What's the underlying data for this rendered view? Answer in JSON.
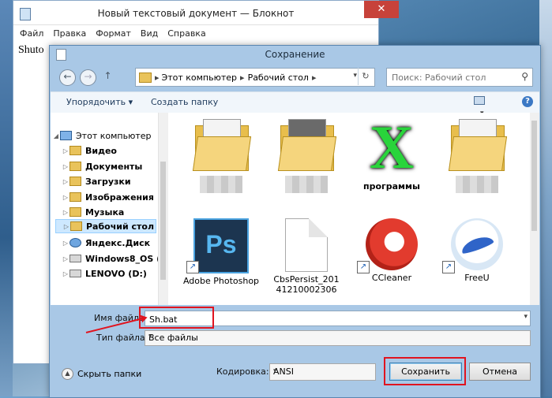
{
  "notepad": {
    "title": "Новый текстовый документ — Блокнот",
    "menu": [
      "Файл",
      "Правка",
      "Формат",
      "Вид",
      "Справка"
    ],
    "body_text": "Shuto",
    "close_glyph": "✕"
  },
  "dialog": {
    "title": "Сохранение",
    "nav": {
      "back": "←",
      "forward": "→",
      "up": "↑"
    },
    "address": {
      "segments": [
        "Этот компьютер",
        "Рабочий стол"
      ],
      "sep": "▸",
      "dropdown": "▾",
      "refresh": "↻"
    },
    "search": {
      "placeholder": "Поиск: Рабочий стол",
      "icon": "⚲"
    },
    "toolbar": {
      "organize": "Упорядочить ▾",
      "new_folder": "Создать папку",
      "help": "?",
      "view_caret": "▾"
    },
    "tree": [
      {
        "label": "Этот компьютер",
        "icon": "pc-icon",
        "expand": "◢"
      },
      {
        "label": "Видео",
        "icon": "folder-icon",
        "expand": "▷"
      },
      {
        "label": "Документы",
        "icon": "folder-icon",
        "expand": "▷"
      },
      {
        "label": "Загрузки",
        "icon": "folder-icon",
        "expand": "▷"
      },
      {
        "label": "Изображения",
        "icon": "folder-icon",
        "expand": "▷"
      },
      {
        "label": "Музыка",
        "icon": "folder-icon",
        "expand": "▷"
      },
      {
        "label": "Рабочий стол",
        "icon": "folder-icon",
        "expand": "▷",
        "selected": true
      },
      {
        "label": "Яндекс.Диск",
        "icon": "cloud-icon",
        "expand": "▷"
      },
      {
        "label": "Windows8_OS (C",
        "icon": "drive-icon",
        "expand": "▷"
      },
      {
        "label": "LENOVO (D:)",
        "icon": "drive-icon",
        "expand": "▷"
      }
    ],
    "files": [
      {
        "label": "",
        "kind": "folder"
      },
      {
        "label": "",
        "kind": "folder"
      },
      {
        "label": "программы",
        "kind": "x-logo",
        "glyph": "X"
      },
      {
        "label": "",
        "kind": "folder"
      },
      {
        "label": "Adobe Photoshop",
        "kind": "photoshop",
        "glyph": "Ps"
      },
      {
        "label": "CbsPersist_20141210002306",
        "kind": "document"
      },
      {
        "label": "CCleaner",
        "kind": "ccleaner"
      },
      {
        "label": "FreeU",
        "kind": "freeu"
      }
    ],
    "shortcut_glyph": "↗",
    "form": {
      "filename_label": "Имя файла:",
      "filename_value": "Sh.bat",
      "filetype_label": "Тип файла:",
      "filetype_value": "Все файлы",
      "hide_folders": "Скрыть папки",
      "hide_glyph": "▲",
      "encoding_label": "Кодировка:",
      "encoding_value": "ANSI",
      "save": "Сохранить",
      "cancel": "Отмена",
      "dd": "▾"
    },
    "accent_red": "#e0141f"
  }
}
